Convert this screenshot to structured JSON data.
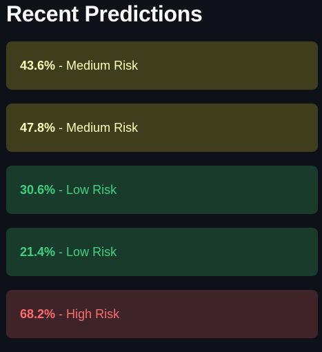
{
  "title": "Recent Predictions",
  "separator": " - ",
  "predictions": [
    {
      "probability": "43.6%",
      "risk_label": "Medium Risk",
      "risk_level": "medium"
    },
    {
      "probability": "47.8%",
      "risk_label": "Medium Risk",
      "risk_level": "medium"
    },
    {
      "probability": "30.6%",
      "risk_label": "Low Risk",
      "risk_level": "low"
    },
    {
      "probability": "21.4%",
      "risk_label": "Low Risk",
      "risk_level": "low"
    },
    {
      "probability": "68.2%",
      "risk_label": "High Risk",
      "risk_level": "high"
    }
  ],
  "colors": {
    "page_background": "#0e1117",
    "title_text": "#fafafa",
    "medium_background": "#3e3e1c",
    "medium_text": "#fdfdbb",
    "low_background": "#193b2b",
    "low_text": "#3fd17e",
    "high_background": "#3e2328",
    "high_text": "#ff6c6c"
  }
}
